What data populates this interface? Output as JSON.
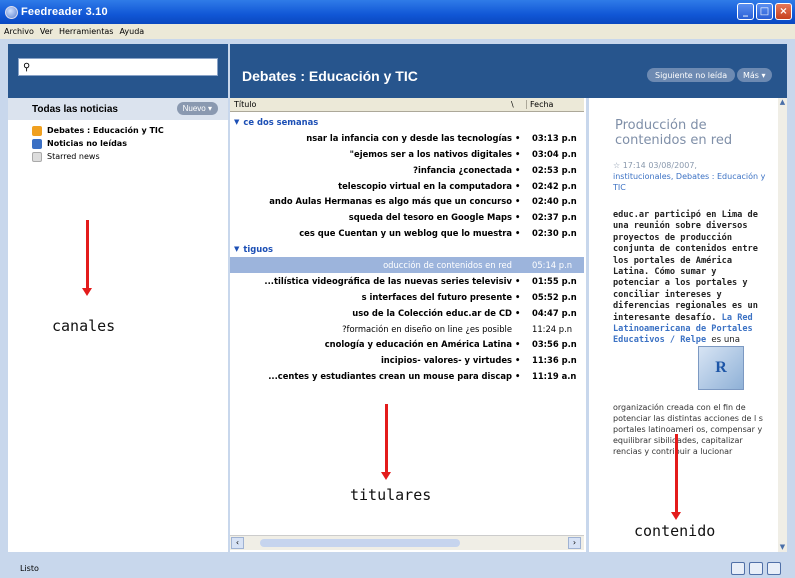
{
  "window": {
    "title": "Feedreader 3.10"
  },
  "menu": [
    "Archivo",
    "Ver",
    "Herramientas",
    "Ayuda"
  ],
  "sidebar": {
    "search_placeholder": "",
    "header": "Todas las noticias",
    "new_button": "Nuevo",
    "feeds": [
      {
        "label": "Debates : Educación y TIC",
        "bold": true,
        "icon": "rss-feed-icon",
        "color": "#f0a020"
      },
      {
        "label": "Noticias no leídas",
        "bold": true,
        "icon": "unread-icon",
        "color": "#3a6fc4"
      },
      {
        "label": "Starred news",
        "bold": false,
        "icon": "star-news-icon",
        "color": "#c9c9c9"
      }
    ]
  },
  "main": {
    "title": "Debates : Educación y TIC",
    "next_unread": "Siguiente no leída",
    "more": "Más",
    "columns": {
      "title": "Título",
      "col2": "\\",
      "date": "Fecha"
    }
  },
  "items": [
    {
      "type": "group",
      "label": "ce dos semanas"
    },
    {
      "type": "item",
      "title": "nsar la infancia con y desde las tecnologías",
      "time": "03:13 p.n",
      "dot": "•"
    },
    {
      "type": "item",
      "title": "ejemos ser a los nativos digitales\"",
      "time": "03:04 p.n",
      "dot": "•"
    },
    {
      "type": "item",
      "title": "infancia ¿conectada?",
      "time": "02:53 p.n",
      "dot": "•"
    },
    {
      "type": "item",
      "title": "telescopio virtual en la computadora",
      "time": "02:42 p.n",
      "dot": "•"
    },
    {
      "type": "item",
      "title": "ando Aulas Hermanas es algo más que un concurso",
      "time": "02:40 p.n",
      "dot": "•"
    },
    {
      "type": "item",
      "title": "squeda del tesoro en Google Maps",
      "time": "02:37 p.n",
      "dot": "•"
    },
    {
      "type": "item",
      "title": "ces que Cuentan y un weblog que lo muestra",
      "time": "02:30 p.n",
      "dot": "•"
    },
    {
      "type": "group",
      "label": "tiguos"
    },
    {
      "type": "selected",
      "title": "oducción de contenidos en red",
      "time": "05:14 p.n",
      "dot": ""
    },
    {
      "type": "item",
      "title": "tilística videográfica de las nuevas series televisiv...",
      "time": "01:55 p.n",
      "dot": "•"
    },
    {
      "type": "item",
      "title": "s interfaces del futuro presente",
      "time": "05:52 p.n",
      "dot": "•"
    },
    {
      "type": "item",
      "title": "uso de la Colección educ.ar de CD",
      "time": "04:47 p.n",
      "dot": "•"
    },
    {
      "type": "light",
      "title": "formación en diseño on line ¿es posible?",
      "time": "11:24 p.n",
      "dot": ""
    },
    {
      "type": "item",
      "title": "cnología y educación en América Latina",
      "time": "03:56 p.n",
      "dot": "•"
    },
    {
      "type": "item",
      "title": "incipios- valores- y virtudes",
      "time": "11:36 p.n",
      "dot": "•"
    },
    {
      "type": "item",
      "title": "centes y estudiantes crean un mouse para discap...",
      "time": "11:19 a.n",
      "dot": "•"
    }
  ],
  "reader": {
    "title": "Producción de contenidos en red",
    "meta_time": "☆ 17:14 03/08/2007,",
    "meta_links": "institucionales, Debates : Educación y TIC",
    "body": "educ.ar participó en Lima de una reunión sobre diversos proyectos de producción conjunta de contenidos entre los portales de América Latina. Cómo sumar y potenciar a los portales y conciliar intereses y diferencias regionales es un interesante desafío.",
    "link_start": "La Red",
    "link_rest": "Latinoamericana de Portales Educativos / Relpe",
    "body2_first": "es una",
    "body2": "organización creada con el fin de potenciar las distintas acciones de l s portales latinoameri  os, compensar y equilibrar  sibilidades, capitalizar  rencias y contribuir a  lucionar",
    "thumb_letter": "R"
  },
  "status": {
    "text": "Listo"
  },
  "annotations": {
    "channels": "canales",
    "headlines": "titulares",
    "content": "contenido"
  },
  "colors": {
    "accent": "#27558d",
    "arrow": "#e31b1b"
  }
}
